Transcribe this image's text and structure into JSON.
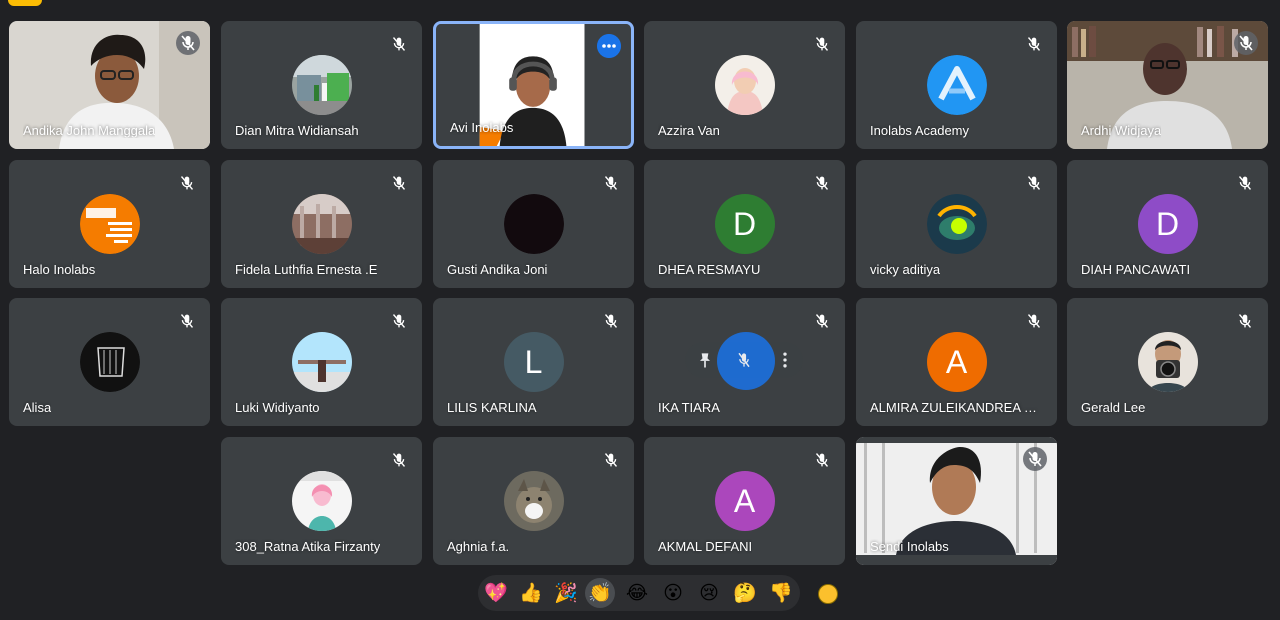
{
  "participants": [
    {
      "name": "Andika John Manggala"
    },
    {
      "name": "Dian Mitra Widiansah"
    },
    {
      "name": "Avi Inolabs"
    },
    {
      "name": "Azzira Van"
    },
    {
      "name": "Inolabs Academy"
    },
    {
      "name": "Ardhi Widjaya"
    },
    {
      "name": "Halo Inolabs",
      "avatar_text": "INOLABS CARVE YOUR WEBSITE NOW!"
    },
    {
      "name": "Fidela Luthfia Ernesta .E"
    },
    {
      "name": "Gusti Andika Joni"
    },
    {
      "name": "DHEA RESMAYU",
      "initial": "D",
      "color": "#2e7d32"
    },
    {
      "name": "vicky aditiya"
    },
    {
      "name": "DIAH PANCAWATI",
      "initial": "D",
      "color": "#8e4cc7"
    },
    {
      "name": "Alisa"
    },
    {
      "name": "Luki Widiyanto"
    },
    {
      "name": "LILIS KARLINA",
      "initial": "L",
      "color": "#455a64"
    },
    {
      "name": "IKA TIARA"
    },
    {
      "name": "ALMIRA ZULEIKANDREA M...",
      "initial": "A",
      "color": "#ef6c00"
    },
    {
      "name": "Gerald Lee"
    },
    {
      "name": "308_Ratna Atika Firzanty"
    },
    {
      "name": "Aghnia f.a."
    },
    {
      "name": "AKMAL DEFANI",
      "initial": "A",
      "color": "#ab47bc"
    },
    {
      "name": "Sendi Inolabs"
    }
  ],
  "reactions": [
    "💖",
    "👍",
    "🎉",
    "👏",
    "😂",
    "😮",
    "😢",
    "🤔",
    "👎"
  ],
  "selected_reaction_index": 3,
  "colors": {
    "background": "#202124",
    "tile": "#3c4043",
    "accent": "#8ab4f8",
    "blue": "#1a73e8"
  }
}
